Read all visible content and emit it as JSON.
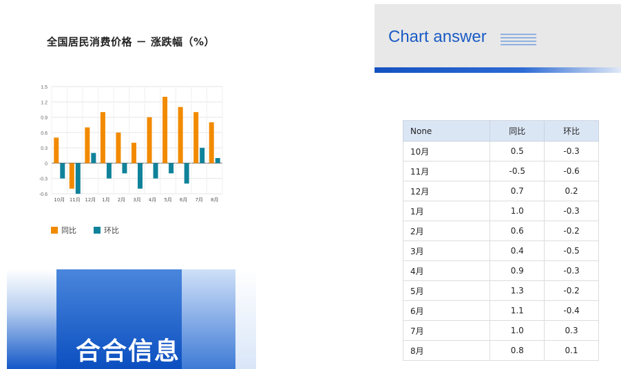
{
  "chart_data": {
    "type": "bar",
    "title": "全国居民消费价格 － 涨跌幅（%）",
    "categories": [
      "10月",
      "11月",
      "12月",
      "1月",
      "2月",
      "3月",
      "4月",
      "5月",
      "6月",
      "7月",
      "8月"
    ],
    "series": [
      {
        "name": "同比",
        "values": [
          0.5,
          -0.5,
          0.7,
          1.0,
          0.6,
          0.4,
          0.9,
          1.3,
          1.1,
          1.0,
          0.8
        ],
        "color": "#f28a00"
      },
      {
        "name": "环比",
        "values": [
          -0.3,
          -0.6,
          0.2,
          -0.3,
          -0.2,
          -0.5,
          -0.3,
          -0.2,
          -0.4,
          0.3,
          0.1
        ],
        "color": "#10829a"
      }
    ],
    "ylim": [
      -0.6,
      1.5
    ],
    "yticks": [
      -0.6,
      -0.3,
      0,
      0.3,
      0.6,
      0.9,
      1.2,
      1.5
    ],
    "ytick_labels": [
      "-0.6",
      "-0.3",
      "0",
      "0.3",
      "0.6",
      "0.9",
      "1.2",
      "1.5"
    ],
    "grid": true,
    "legend": "bottom-left",
    "xlabel": "",
    "ylabel": ""
  },
  "brand": {
    "text": "合合信息"
  },
  "answer": {
    "title": "Chart answer",
    "table": {
      "headers": [
        "None",
        "同比",
        "环比"
      ],
      "rows": [
        [
          "10月",
          "0.5",
          "-0.3"
        ],
        [
          "11月",
          "-0.5",
          "-0.6"
        ],
        [
          "12月",
          "0.7",
          "0.2"
        ],
        [
          "1月",
          "1.0",
          "-0.3"
        ],
        [
          "2月",
          "0.6",
          "-0.2"
        ],
        [
          "3月",
          "0.4",
          "-0.5"
        ],
        [
          "4月",
          "0.9",
          "-0.3"
        ],
        [
          "5月",
          "1.3",
          "-0.2"
        ],
        [
          "6月",
          "1.1",
          "-0.4"
        ],
        [
          "7月",
          "1.0",
          "0.3"
        ],
        [
          "8月",
          "0.8",
          "0.1"
        ]
      ]
    }
  }
}
